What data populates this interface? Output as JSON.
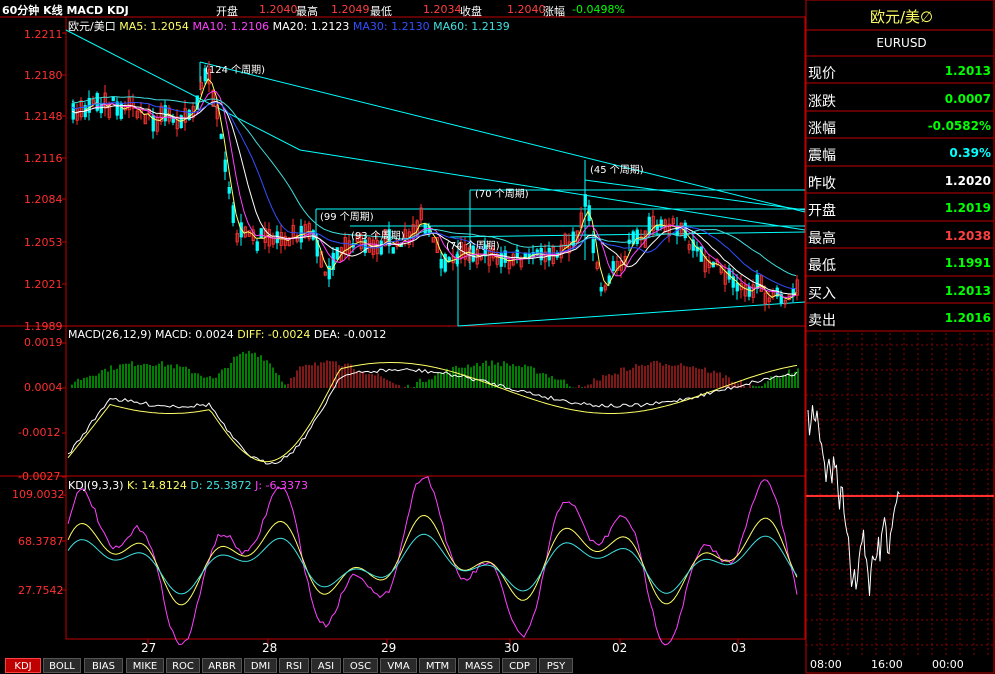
{
  "header": {
    "title": "60分钟 K线 MACD KDJ",
    "open_label": "开盘",
    "open_value": "1.2040",
    "high_label": "最高",
    "high_value": "1.2049",
    "low_label": "最低",
    "low_value": "1.2034",
    "close_label": "收盘",
    "close_value": "1.2040",
    "change_label": "涨幅",
    "change_value": "-0.0498%"
  },
  "main_legend": {
    "symbol": "欧元/美口",
    "ma5": "MA5: 1.2054",
    "ma10": "MA10: 1.2106",
    "ma20": "MA20: 1.2123",
    "ma30": "MA30: 1.2130",
    "ma60": "MA60: 1.2139"
  },
  "price_axis": [
    "1.2211",
    "1.2180",
    "1.2148",
    "1.2116",
    "1.2084",
    "1.2053",
    "1.2021",
    "1.1989"
  ],
  "cycle_annotations": [
    "(124 个周期)",
    "(99 个周期)",
    "(93 个周期)",
    "(74 个周期)",
    "(70 个周期)",
    "(45 个周期)"
  ],
  "macd": {
    "legend": "MACD(26,12,9)",
    "macd_value": "MACD: 0.0024",
    "diff_value": "DIFF: -0.0024",
    "dea_value": "DEA: -0.0012",
    "axis": [
      "0.0019",
      "0.0004",
      "-0.0012",
      "-0.0027"
    ]
  },
  "kdj": {
    "legend": "KDJ(9,3,3)",
    "k_value": "K: 14.8124",
    "d_value": "D: 25.3872",
    "j_value": "J: -6.3373",
    "axis": [
      "109.0032",
      "68.3787",
      "27.7542"
    ]
  },
  "date_labels": [
    "27",
    "28",
    "29",
    "30",
    "02",
    "03"
  ],
  "tabs": [
    {
      "label": "KDJ",
      "active": true
    },
    {
      "label": "BOLL",
      "active": false
    },
    {
      "label": "BIAS",
      "active": false
    },
    {
      "label": "MIKE",
      "active": false
    },
    {
      "label": "ROC",
      "active": false
    },
    {
      "label": "ARBR",
      "active": false
    },
    {
      "label": "DMI",
      "active": false
    },
    {
      "label": "RSI",
      "active": false
    },
    {
      "label": "ASI",
      "active": false
    },
    {
      "label": "OSC",
      "active": false
    },
    {
      "label": "VMA",
      "active": false
    },
    {
      "label": "MTM",
      "active": false
    },
    {
      "label": "MASS",
      "active": false
    },
    {
      "label": "CDP",
      "active": false
    },
    {
      "label": "PSY",
      "active": false
    }
  ],
  "quote_panel": {
    "name": "欧元/美∅",
    "code": "EURUSD",
    "rows": [
      {
        "label": "现价",
        "value": "1.2013",
        "color": "#00ff00"
      },
      {
        "label": "涨跌",
        "value": "0.0007",
        "color": "#00ff00"
      },
      {
        "label": "涨幅",
        "value": "-0.0582%",
        "color": "#00ff00"
      },
      {
        "label": "震幅",
        "value": "0.39%",
        "color": "#00ffff"
      },
      {
        "label": "昨收",
        "value": "1.2020",
        "color": "#ffffff"
      },
      {
        "label": "开盘",
        "value": "1.2019",
        "color": "#00ff00"
      },
      {
        "label": "最高",
        "value": "1.2038",
        "color": "#ff4040"
      },
      {
        "label": "最低",
        "value": "1.1991",
        "color": "#00ff00"
      },
      {
        "label": "买入",
        "value": "1.2013",
        "color": "#00ff00"
      },
      {
        "label": "卖出",
        "value": "1.2016",
        "color": "#00ff00"
      }
    ]
  },
  "intraday_axis": [
    "08:00",
    "16:00",
    "00:00"
  ],
  "colors": {
    "border": "#c00000",
    "grid": "#8b0000",
    "axis_text": "#ff3030",
    "up": "#ff3030",
    "down": "#00ffff",
    "ma5": "#ffff66",
    "ma10": "#ff40ff",
    "ma20": "#ffffff",
    "ma30": "#3050ff",
    "ma60": "#40e0e0"
  }
}
